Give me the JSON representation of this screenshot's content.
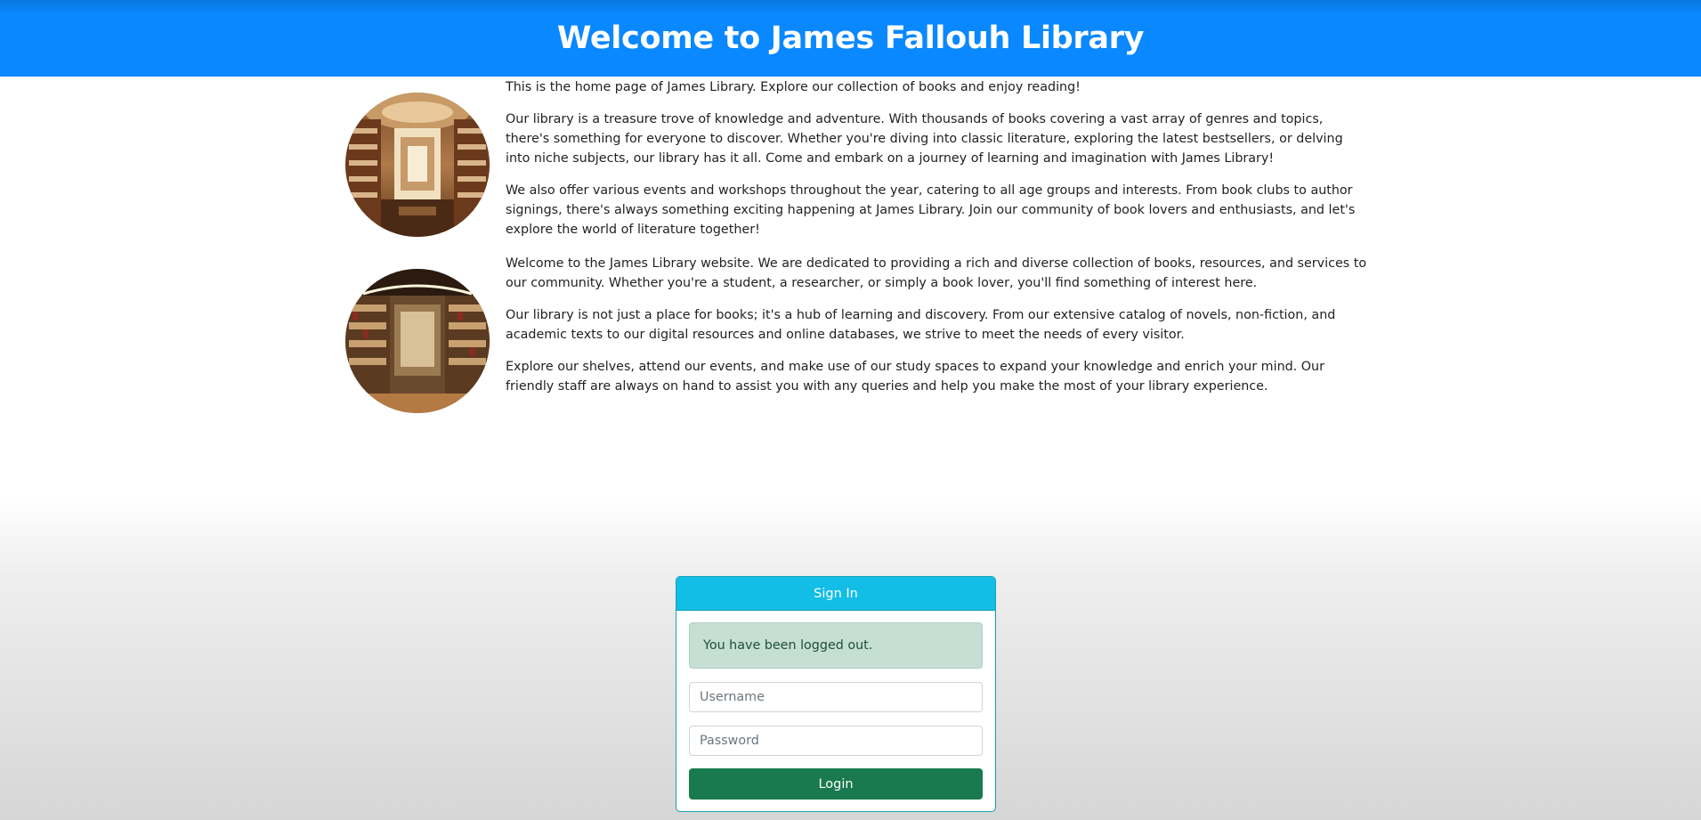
{
  "header": {
    "title": "Welcome to James Fallouh Library"
  },
  "section1": {
    "image": "library-hall-photo",
    "paragraphs": [
      "This is the home page of James Library. Explore our collection of books and enjoy reading!",
      "Our library is a treasure trove of knowledge and adventure. With thousands of books covering a vast array of genres and topics, there's something for everyone to discover. Whether you're diving into classic literature, exploring the latest bestsellers, or delving into niche subjects, our library has it all. Come and embark on a journey of learning and imagination with James Library!",
      "We also offer various events and workshops throughout the year, catering to all age groups and interests. From book clubs to author signings, there's always something exciting happening at James Library. Join our community of book lovers and enthusiasts, and let's explore the world of literature together!"
    ]
  },
  "section2": {
    "image": "bookshelves-room-photo",
    "paragraphs": [
      "Welcome to the James Library website. We are dedicated to providing a rich and diverse collection of books, resources, and services to our community. Whether you're a student, a researcher, or simply a book lover, you'll find something of interest here.",
      "Our library is not just a place for books; it's a hub of learning and discovery. From our extensive catalog of novels, non-fiction, and academic texts to our digital resources and online databases, we strive to meet the needs of every visitor.",
      "Explore our shelves, attend our events, and make use of our study spaces to expand your knowledge and enrich your mind. Our friendly staff are always on hand to assist you with any queries and help you make the most of your library experience."
    ]
  },
  "signin": {
    "title": "Sign In",
    "alert": "You have been logged out.",
    "username_placeholder": "Username",
    "password_placeholder": "Password",
    "login_label": "Login"
  },
  "colors": {
    "header_bg": "#0a88ff",
    "card_header_bg": "#12bde6",
    "alert_bg": "#c6dfd5",
    "login_button_bg": "#197a4f"
  }
}
